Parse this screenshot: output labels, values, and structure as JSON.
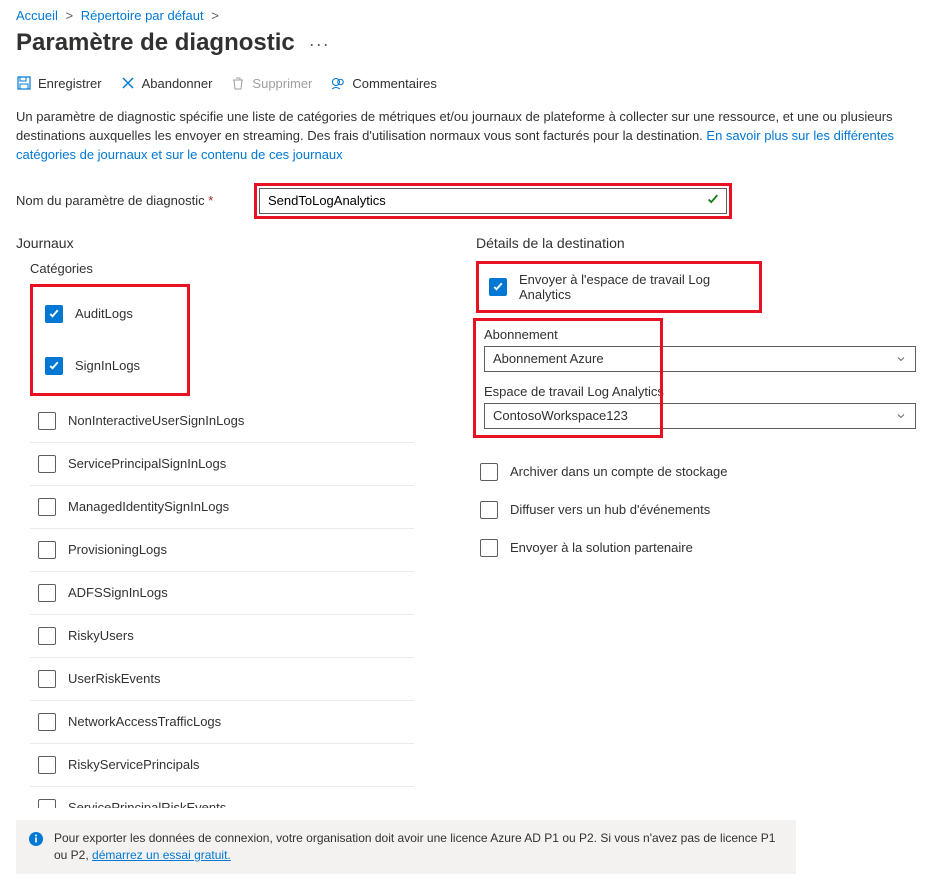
{
  "breadcrumb": {
    "home": "Accueil",
    "dir": "Répertoire par défaut"
  },
  "page_title": "Paramètre de diagnostic",
  "toolbar": {
    "save": "Enregistrer",
    "discard": "Abandonner",
    "delete": "Supprimer",
    "feedback": "Commentaires"
  },
  "description": {
    "text": "Un paramètre de diagnostic spécifie une liste de catégories de métriques et/ou journaux de plateforme à collecter sur une ressource, et une ou plusieurs destinations auxquelles les envoyer en streaming. Des frais d'utilisation normaux vous sont facturés pour la destination. ",
    "link": "En savoir plus sur les différentes catégories de journaux et sur le contenu de ces journaux"
  },
  "name_field": {
    "label": "Nom du paramètre de diagnostic",
    "value": "SendToLogAnalytics"
  },
  "logs_heading": "Journaux",
  "categories_heading": "Catégories",
  "categories": [
    {
      "label": "AuditLogs",
      "checked": true
    },
    {
      "label": "SignInLogs",
      "checked": true
    },
    {
      "label": "NonInteractiveUserSignInLogs",
      "checked": false
    },
    {
      "label": "ServicePrincipalSignInLogs",
      "checked": false
    },
    {
      "label": "ManagedIdentitySignInLogs",
      "checked": false
    },
    {
      "label": "ProvisioningLogs",
      "checked": false
    },
    {
      "label": "ADFSSignInLogs",
      "checked": false
    },
    {
      "label": "RiskyUsers",
      "checked": false
    },
    {
      "label": "UserRiskEvents",
      "checked": false
    },
    {
      "label": "NetworkAccessTrafficLogs",
      "checked": false
    },
    {
      "label": "RiskyServicePrincipals",
      "checked": false
    },
    {
      "label": "ServicePrincipalRiskEvents",
      "checked": false
    }
  ],
  "destination": {
    "heading": "Détails de la destination",
    "send_law": {
      "label": "Envoyer à l'espace de travail Log Analytics",
      "checked": true
    },
    "subscription_label": "Abonnement",
    "subscription_value": "Abonnement Azure",
    "workspace_label": "Espace de travail Log Analytics",
    "workspace_value": "ContosoWorkspace123",
    "archive": "Archiver dans un compte de stockage",
    "eventhub": "Diffuser vers un hub d'événements",
    "partner": "Envoyer à la solution partenaire"
  },
  "info": {
    "text": "Pour exporter les données de connexion, votre organisation doit avoir une licence Azure AD P1 ou P2. Si vous n'avez pas de licence P1 ou P2, ",
    "link": "démarrez un essai gratuit."
  }
}
